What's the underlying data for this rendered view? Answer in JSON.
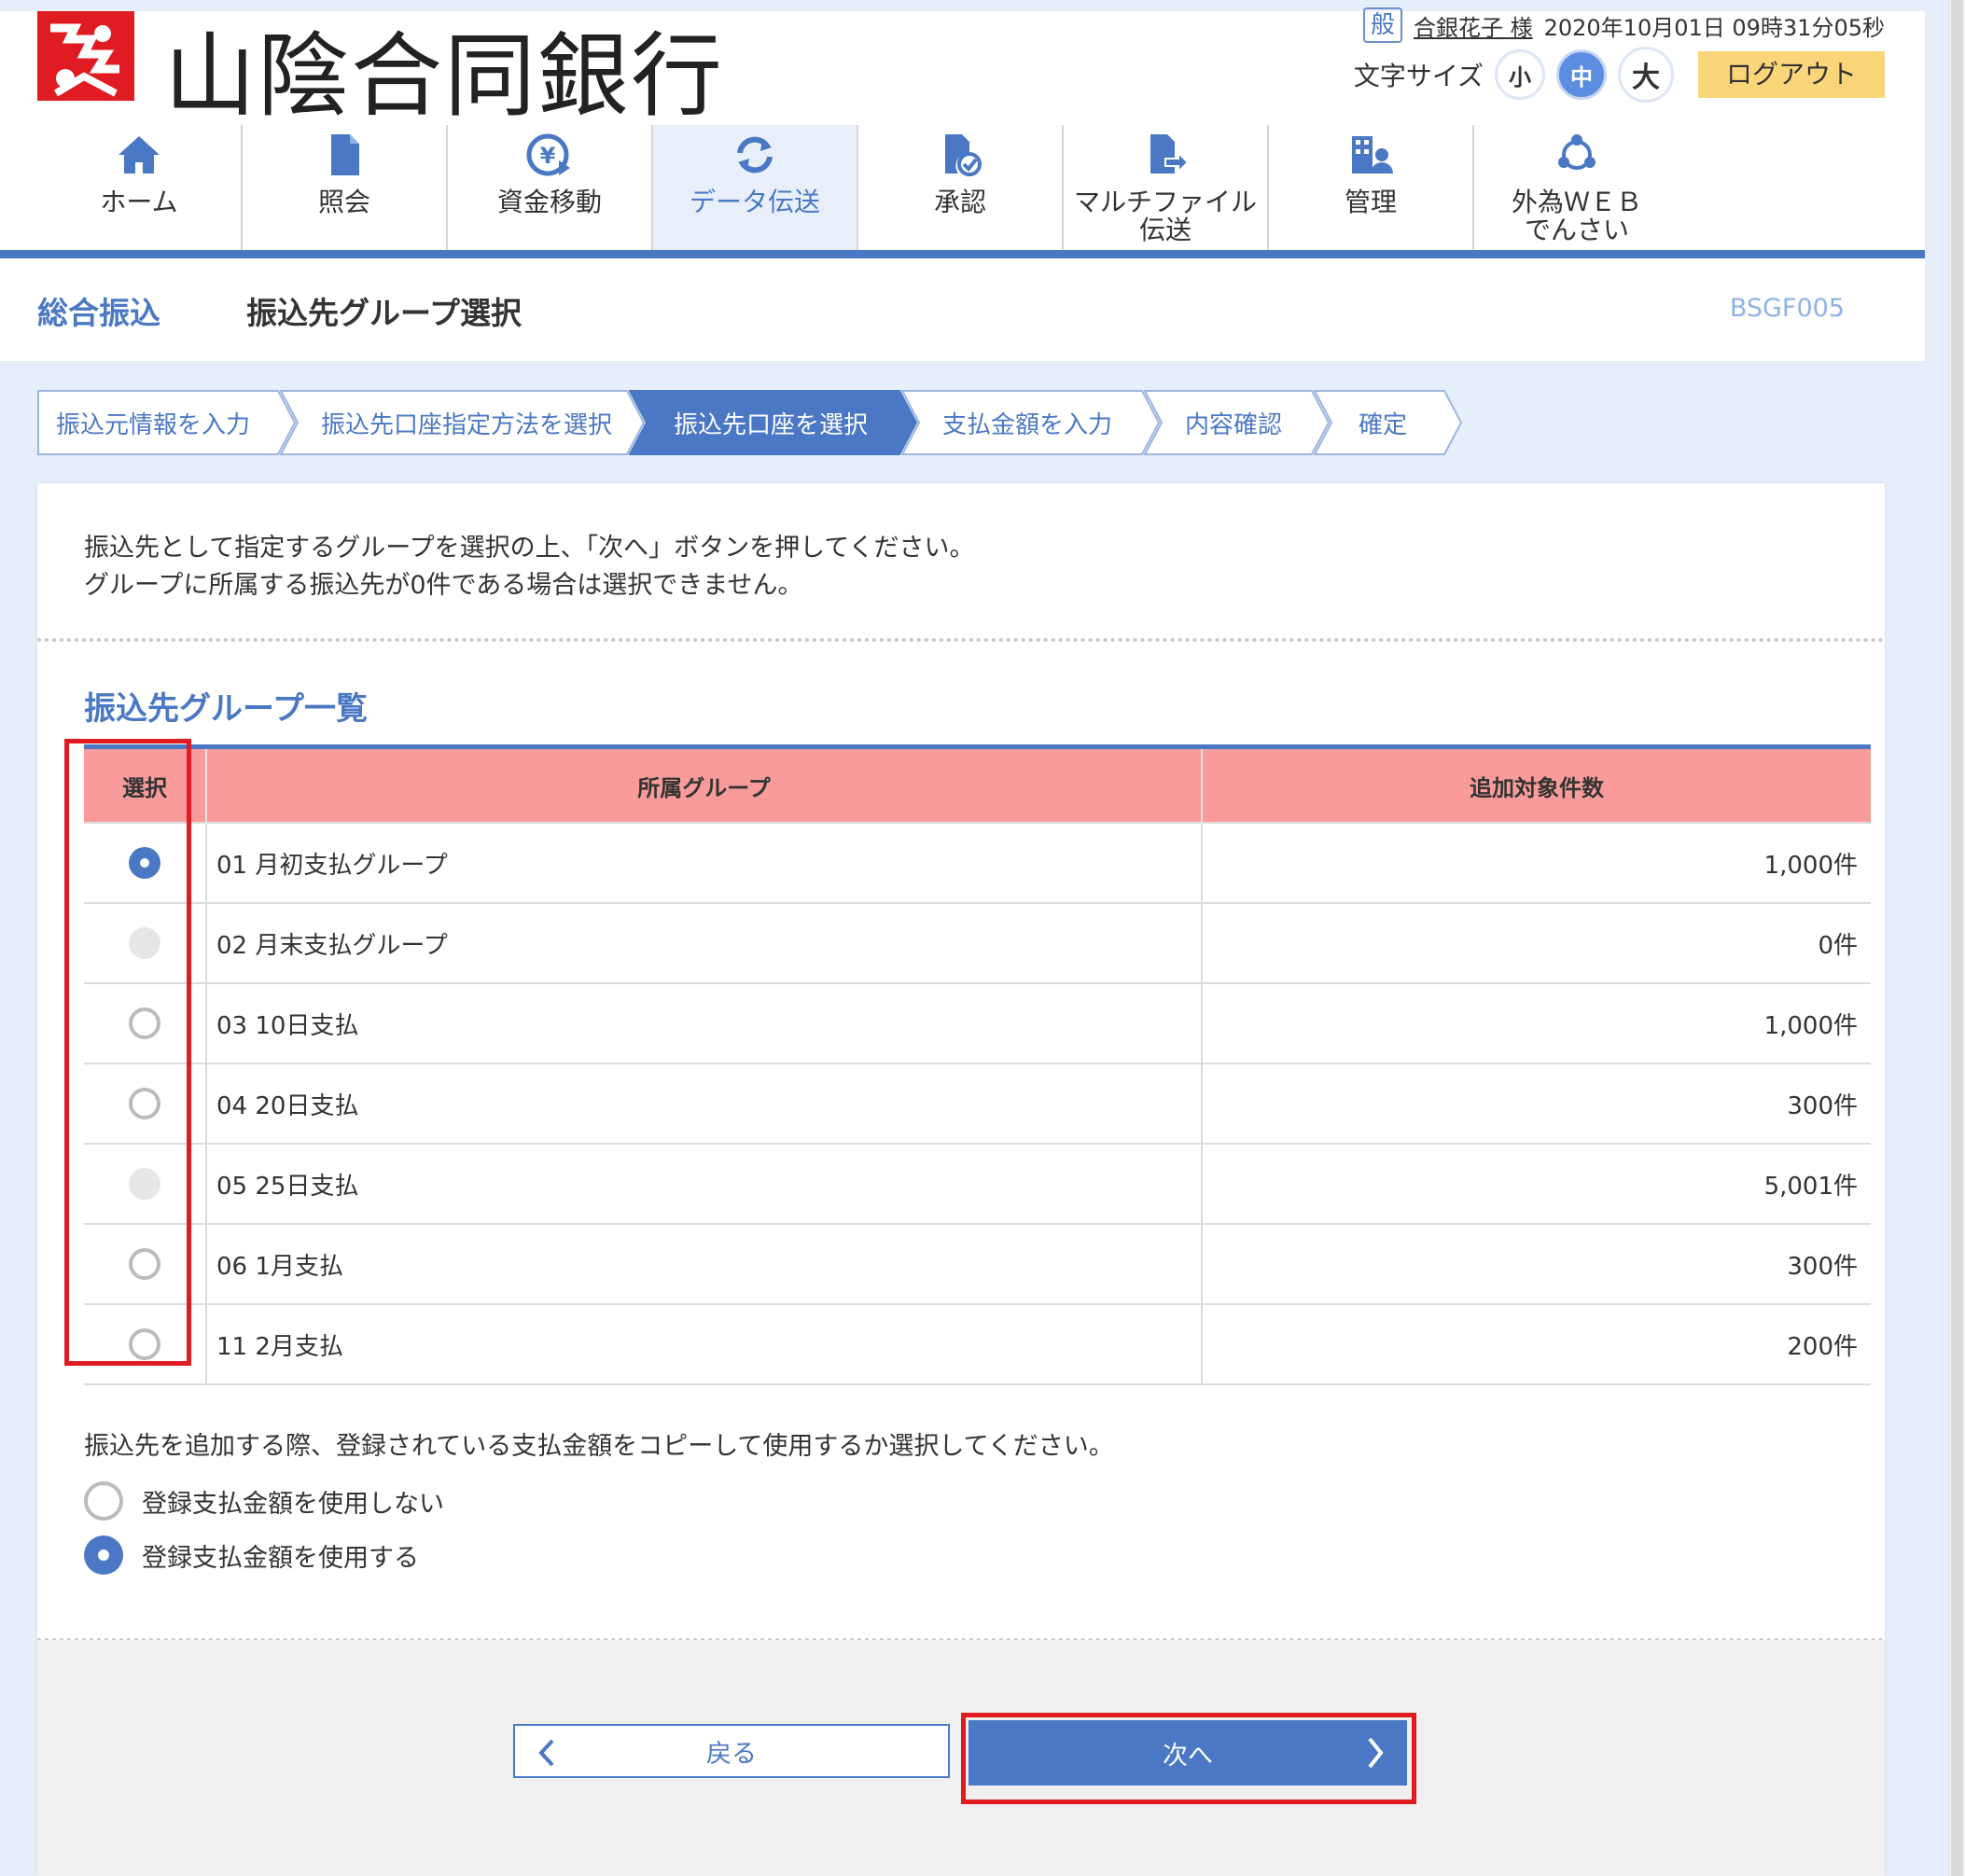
{
  "header": {
    "bank_name": "山陰合同銀行",
    "role_badge": "般",
    "user_name": "合銀花子 様",
    "datetime": "2020年10月01日 09時31分05秒",
    "font_size_label": "文字サイズ",
    "font_sizes": [
      "小",
      "中",
      "大"
    ],
    "active_font_size": "中",
    "logout_label": "ログアウト"
  },
  "nav": [
    {
      "label": "ホーム",
      "icon": "home-icon"
    },
    {
      "label": "照会",
      "icon": "document-icon"
    },
    {
      "label": "資金移動",
      "icon": "yen-transfer-icon"
    },
    {
      "label": "データ伝送",
      "icon": "sync-icon",
      "active": true
    },
    {
      "label": "承認",
      "icon": "approval-icon"
    },
    {
      "label": "マルチファイル\n伝送",
      "label_line1": "マルチファイル",
      "label_line2": "伝送",
      "icon": "file-upload-icon"
    },
    {
      "label": "管理",
      "icon": "management-icon"
    },
    {
      "label": "外為ＷＥＢ\nでんさい",
      "label_line1": "外為ＷＥＢ",
      "label_line2": "でんさい",
      "icon": "network-icon"
    }
  ],
  "title": {
    "category": "総合振込",
    "page": "振込先グループ選択",
    "code": "BSGF005"
  },
  "steps": [
    "振込元情報を入力",
    "振込先口座指定方法を選択",
    "振込先口座を選択",
    "支払金額を入力",
    "内容確認",
    "確定"
  ],
  "active_step": 2,
  "intro": {
    "line1": "振込先として指定するグループを選択の上、「次へ」ボタンを押してください。",
    "line2": "グループに所属する振込先が0件である場合は選択できません。"
  },
  "group_list": {
    "title": "振込先グループ一覧",
    "headers": [
      "選択",
      "所属グループ",
      "追加対象件数"
    ],
    "rows": [
      {
        "name": "01 月初支払グループ",
        "count": "1,000件",
        "state": "checked"
      },
      {
        "name": "02 月末支払グループ",
        "count": "0件",
        "state": "disabled"
      },
      {
        "name": "03 10日支払",
        "count": "1,000件",
        "state": "unchecked"
      },
      {
        "name": "04 20日支払",
        "count": "300件",
        "state": "unchecked"
      },
      {
        "name": "05 25日支払",
        "count": "5,001件",
        "state": "disabled"
      },
      {
        "name": "06 1月支払",
        "count": "300件",
        "state": "unchecked"
      },
      {
        "name": "11 2月支払",
        "count": "200件",
        "state": "unchecked"
      }
    ]
  },
  "copy_amount": {
    "question": "振込先を追加する際、登録されている支払金額をコピーして使用するか選択してください。",
    "options": [
      {
        "label": "登録支払金額を使用しない",
        "checked": false
      },
      {
        "label": "登録支払金額を使用する",
        "checked": true
      }
    ]
  },
  "buttons": {
    "back": "戻る",
    "next": "次へ"
  },
  "colors": {
    "accent": "#4a78c4",
    "table_header": "#f99b9b",
    "highlight": "#e11b22",
    "logout": "#fbd57a"
  }
}
